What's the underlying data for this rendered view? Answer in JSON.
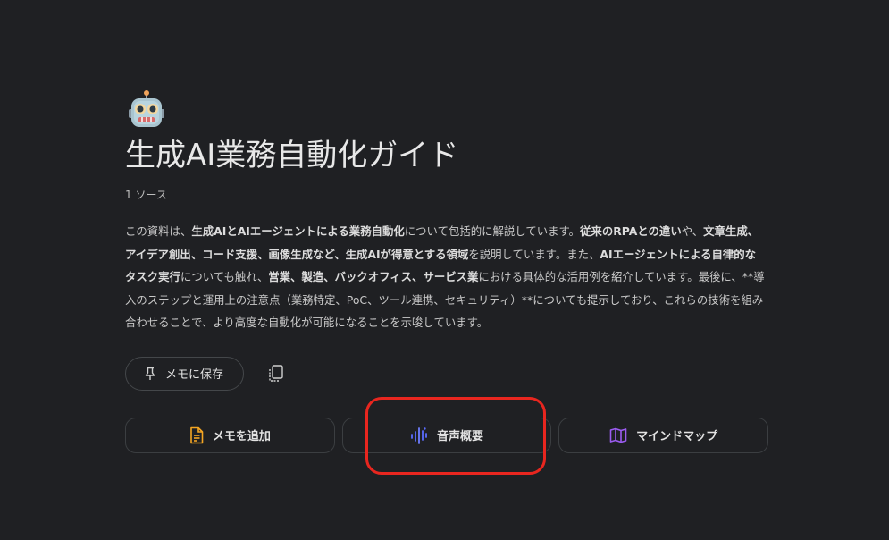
{
  "notebook": {
    "title": "生成AI業務自動化ガイド",
    "source_count": "1 ソース",
    "emoji_icon": "robot-face-icon"
  },
  "summary": {
    "segments": [
      {
        "text": "この資料は、",
        "bold": false
      },
      {
        "text": "生成AIとAIエージェントによる業務自動化",
        "bold": true
      },
      {
        "text": "について包括的に解説しています。",
        "bold": false
      },
      {
        "text": "従来のRPAとの違い",
        "bold": true
      },
      {
        "text": "や、",
        "bold": false
      },
      {
        "text": "文章生成、アイデア創出、コード支援、画像生成など、生成AIが得意とする領域",
        "bold": true
      },
      {
        "text": "を説明しています。また、",
        "bold": false
      },
      {
        "text": "AIエージェントによる自律的なタスク実行",
        "bold": true
      },
      {
        "text": "についても触れ、",
        "bold": false
      },
      {
        "text": "営業、製造、バックオフィス、サービス業",
        "bold": true
      },
      {
        "text": "における具体的な活用例を紹介しています。最後に、**導入のステップと運用上の注意点（業務特定、PoC、ツール連携、セキュリティ）**についても提示しており、これらの技術を組み合わせることで、より高度な自動化が可能になることを示唆しています。",
        "bold": false
      }
    ]
  },
  "actions": {
    "save_memo_label": "メモに保存",
    "add_memo_label": "メモを追加",
    "audio_overview_label": "音声概要",
    "mind_map_label": "マインドマップ"
  },
  "colors": {
    "background": "#1f2023",
    "memo_icon": "#f5a623",
    "audio_icon": "#5b6cff",
    "mindmap_icon": "#9b5cf0",
    "highlight": "#e8261f"
  }
}
